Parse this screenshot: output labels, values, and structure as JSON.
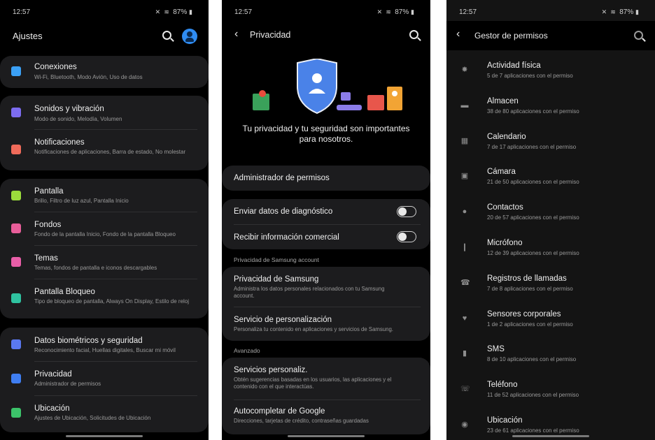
{
  "screen1": {
    "status": {
      "time": "12:57",
      "battery": "87%"
    },
    "title": "Ajustes",
    "groups": [
      [
        {
          "title": "Conexiones",
          "subtitle": "Wi-Fi, Bluetooth, Modo Avión, Uso de datos",
          "icon": "wifi-icon",
          "color": "#3ba0f5"
        }
      ],
      [
        {
          "title": "Sonidos y vibración",
          "subtitle": "Modo de sonido, Melodía, Volumen",
          "icon": "speaker-icon",
          "color": "#7c6cf0"
        },
        {
          "title": "Notificaciones",
          "subtitle": "Notificaciones de aplicaciones, Barra de estado, No molestar",
          "icon": "notification-icon",
          "color": "#f06b5a"
        }
      ],
      [
        {
          "title": "Pantalla",
          "subtitle": "Brillo, Filtro de luz azul, Pantalla Inicio",
          "icon": "brightness-icon",
          "color": "#9bdc3c"
        },
        {
          "title": "Fondos",
          "subtitle": "Fondo de la pantalla Inicio, Fondo de la pantalla Bloqueo",
          "icon": "wallpaper-icon",
          "color": "#e85e9a"
        },
        {
          "title": "Temas",
          "subtitle": "Temas, fondos de pantalla e iconos descargables",
          "icon": "themes-icon",
          "color": "#e85ea8"
        },
        {
          "title": "Pantalla Bloqueo",
          "subtitle": "Tipo de bloqueo de pantalla, Always On Display, Estilo de reloj",
          "icon": "lock-icon",
          "color": "#2fc2a0"
        }
      ],
      [
        {
          "title": "Datos biométricos y seguridad",
          "subtitle": "Reconocimiento facial, Huellas digitales, Buscar mi móvil",
          "icon": "shield-icon",
          "color": "#5a78f0"
        },
        {
          "title": "Privacidad",
          "subtitle": "Administrador de permisos",
          "icon": "privacy-icon",
          "color": "#3f7ef2"
        },
        {
          "title": "Ubicación",
          "subtitle": "Ajustes de Ubicación, Solicitudes de Ubicación",
          "icon": "location-icon",
          "color": "#3cc36a"
        }
      ]
    ]
  },
  "screen2": {
    "status": {
      "time": "12:57",
      "battery": "87%"
    },
    "title": "Privacidad",
    "tagline": "Tu privacidad y tu seguridad son importantes para nosotros.",
    "permission_manager": "Administrador de permisos",
    "toggles": [
      {
        "label": "Enviar datos de diagnóstico",
        "on": false
      },
      {
        "label": "Recibir información comercial",
        "on": false
      }
    ],
    "section_samsung": "Privacidad de Samsung account",
    "samsung_items": [
      {
        "title": "Privacidad de Samsung",
        "subtitle": "Administra los datos personales relacionados con tu Samsung account."
      },
      {
        "title": "Servicio de personalización",
        "subtitle": "Personaliza tu contenido en aplicaciones y servicios de Samsung."
      }
    ],
    "section_advanced": "Avanzado",
    "advanced_items": [
      {
        "title": "Servicios personaliz.",
        "subtitle": "Obtén sugerencias basadas en los usuarios, las aplicaciones y el contenido con el que interactúas."
      },
      {
        "title": "Autocompletar de Google",
        "subtitle": "Direcciones, tarjetas de crédito, contraseñas guardadas"
      }
    ]
  },
  "screen3": {
    "status": {
      "time": "12:57",
      "battery": "87%"
    },
    "title": "Gestor de permisos",
    "permissions": [
      {
        "title": "Actividad física",
        "subtitle": "5 de 7 aplicaciones con el permiso",
        "icon": "run-icon",
        "glyph": "✸"
      },
      {
        "title": "Almacen",
        "subtitle": "38 de 80 aplicaciones con el permiso",
        "icon": "folder-icon",
        "glyph": "▬"
      },
      {
        "title": "Calendario",
        "subtitle": "7 de 17 aplicaciones con el permiso",
        "icon": "calendar-icon",
        "glyph": "▦"
      },
      {
        "title": "Cámara",
        "subtitle": "21 de 50 aplicaciones con el permiso",
        "icon": "camera-icon",
        "glyph": "▣"
      },
      {
        "title": "Contactos",
        "subtitle": "20 de 57 aplicaciones con el permiso",
        "icon": "person-icon",
        "glyph": "●"
      },
      {
        "title": "Micrófono",
        "subtitle": "12 de 39 aplicaciones con el permiso",
        "icon": "mic-icon",
        "glyph": "❙"
      },
      {
        "title": "Registros de llamadas",
        "subtitle": "7 de 8 aplicaciones con el permiso",
        "icon": "call-log-icon",
        "glyph": "☎"
      },
      {
        "title": "Sensores corporales",
        "subtitle": "1 de 2 aplicaciones con el permiso",
        "icon": "heart-icon",
        "glyph": "♥"
      },
      {
        "title": "SMS",
        "subtitle": "8 de 10 aplicaciones con el permiso",
        "icon": "message-icon",
        "glyph": "▮"
      },
      {
        "title": "Teléfono",
        "subtitle": "11 de 52 aplicaciones con el permiso",
        "icon": "phone-icon",
        "glyph": "☏"
      },
      {
        "title": "Ubicación",
        "subtitle": "23 de 61 aplicaciones con el permiso",
        "icon": "location-icon",
        "glyph": "◉"
      }
    ]
  }
}
